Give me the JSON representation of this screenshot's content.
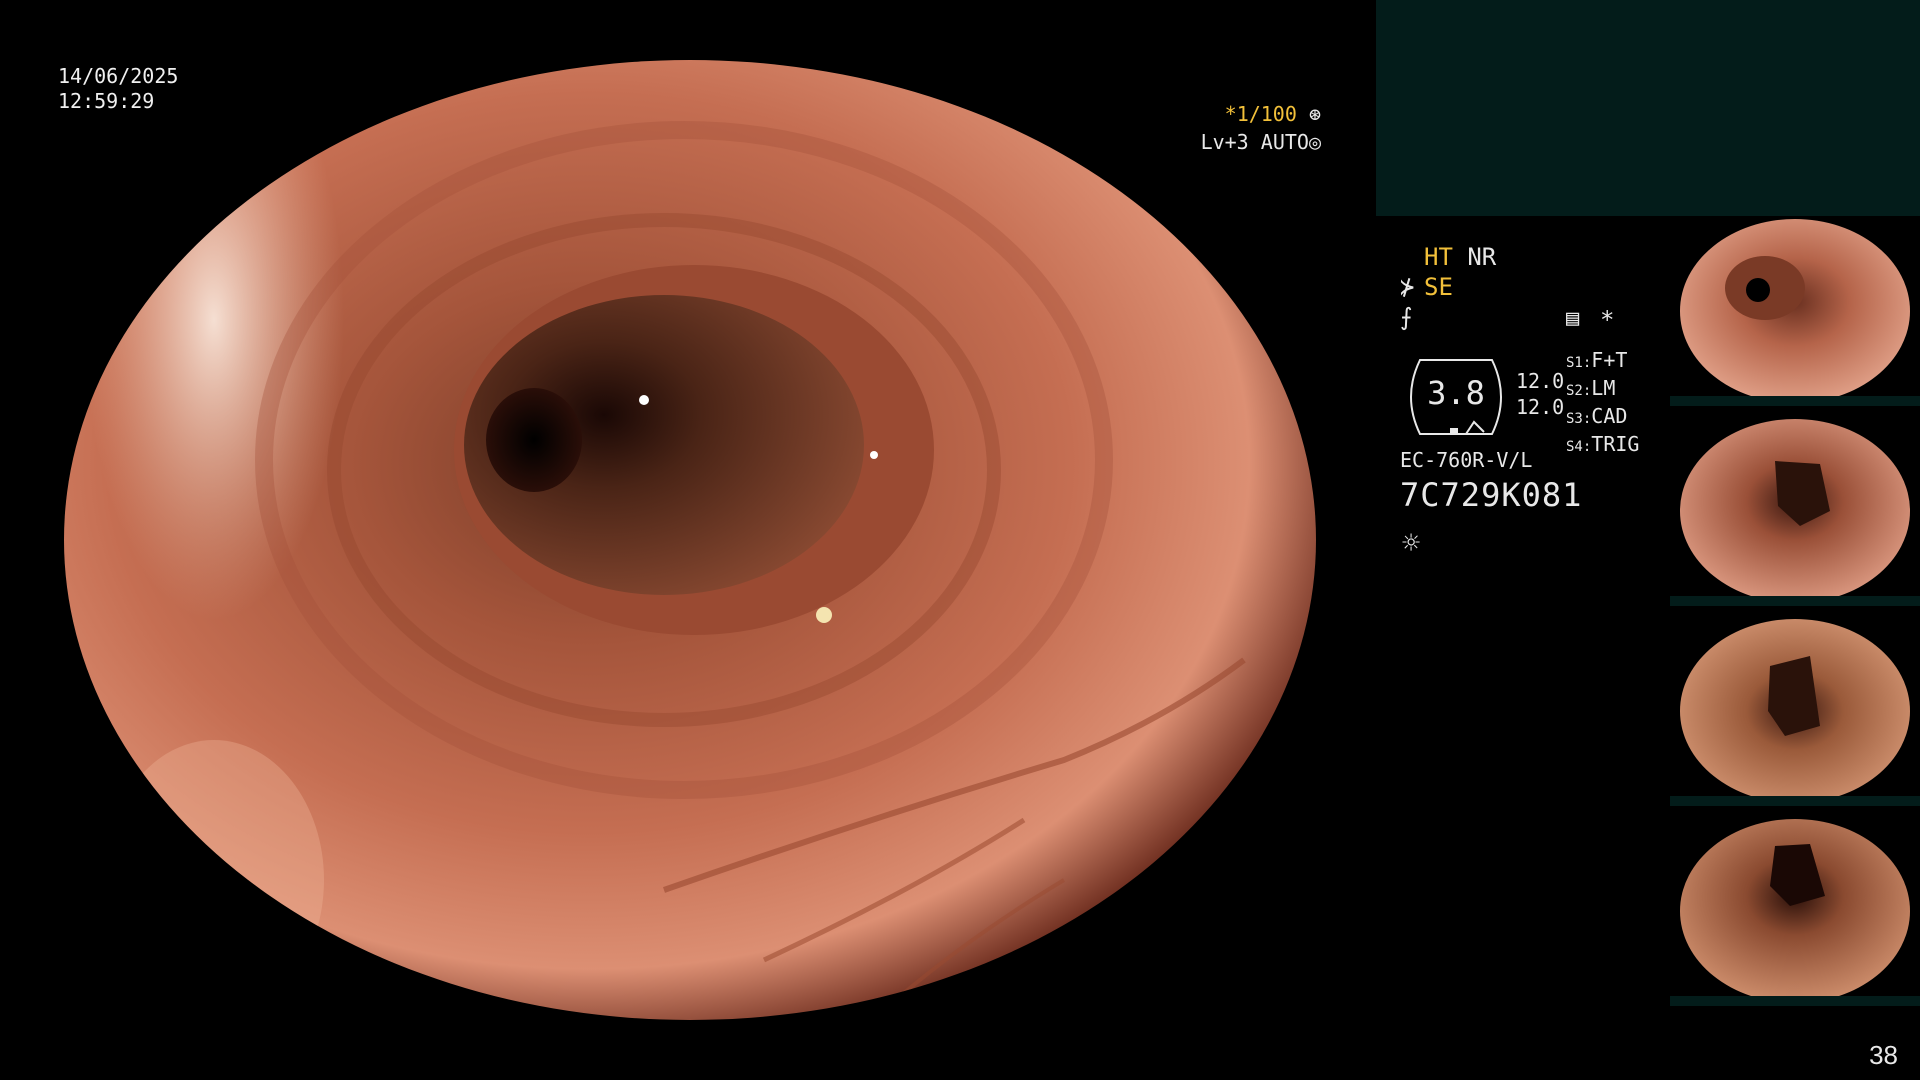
{
  "overlay": {
    "date": "14/06/2025",
    "time": "12:59:29",
    "shutter_prefix": "*",
    "shutter": "1/100",
    "shutter_icon": "aperture-icon",
    "level": "Lv+3",
    "mode": "AUTO",
    "mode_icon": "iris-icon"
  },
  "panel": {
    "mode_line1_a": "HT",
    "mode_line1_b": "NR",
    "mode_line2": "SE",
    "gauge_value": "3.8",
    "gauge_val1": "12.0",
    "gauge_val2": "12.0",
    "slots": [
      {
        "key": "S1:",
        "value": "F+T"
      },
      {
        "key": "S2:",
        "value": "LM"
      },
      {
        "key": "S3:",
        "value": "CAD"
      },
      {
        "key": "S4:",
        "value": "TRIG"
      }
    ],
    "model": "EC-760R-V/L",
    "serial": "7C729K081",
    "icons": [
      "settings-list-icon",
      "asterisk-icon",
      "light-bulb-icon",
      "bending-icon",
      "freeze-icon"
    ]
  },
  "page_number": "38",
  "colors": {
    "mucosa": "#c8745a",
    "lumen": "#3a1810",
    "top_panel": "#031c1a",
    "accent_yellow": "#f2c03a"
  }
}
